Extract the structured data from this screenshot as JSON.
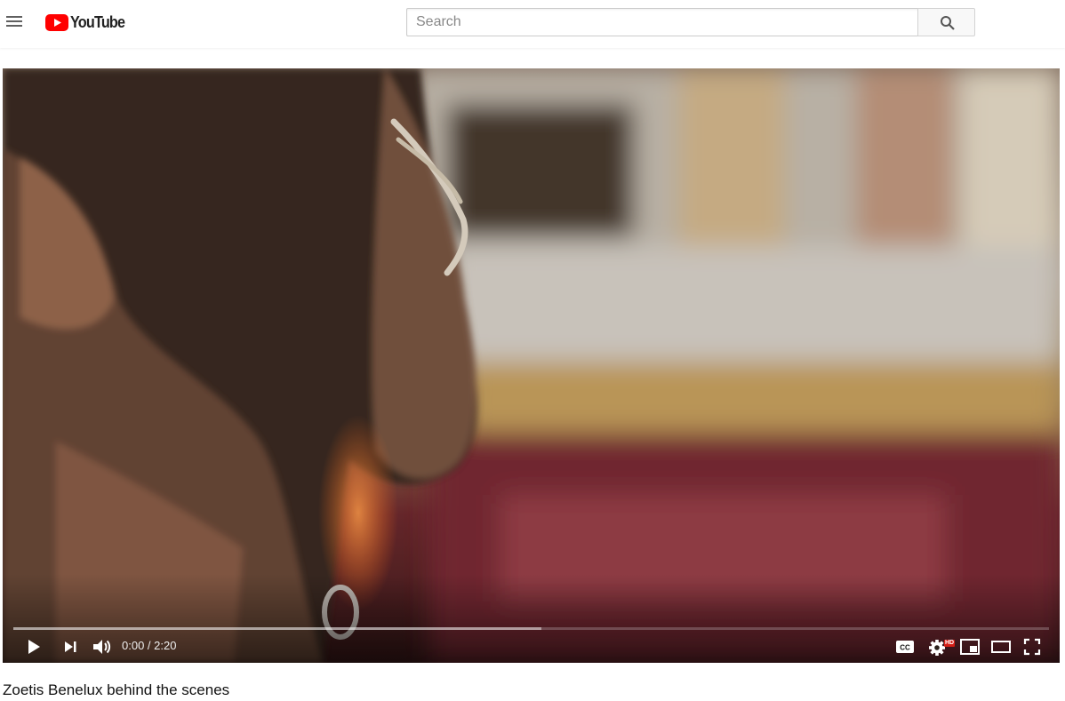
{
  "header": {
    "logo_text": "YouTube",
    "search_placeholder": "Search",
    "menu_icon": "hamburger-menu-icon",
    "search_icon": "magnifier-icon"
  },
  "player": {
    "current_time": "0:00",
    "separator": " / ",
    "duration": "2:20",
    "buffered_fraction": 0.51,
    "hd_badge": "HD",
    "icons": [
      "play-icon",
      "next-icon",
      "volume-icon",
      "captions-icon",
      "settings-icon",
      "miniplayer-icon",
      "theater-icon",
      "fullscreen-icon"
    ]
  },
  "video": {
    "title": "Zoetis Benelux behind the scenes"
  },
  "colors": {
    "brand_red": "#ff0000",
    "hd_red": "#d61e16",
    "text_primary": "#111111"
  }
}
